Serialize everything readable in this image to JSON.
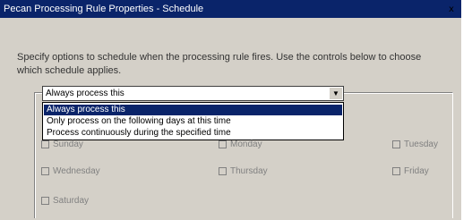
{
  "window": {
    "title": "Pecan Processing Rule Properties - Schedule",
    "close_glyph": "x"
  },
  "description": "Specify options to schedule when the processing rule fires. Use the controls below to choose which schedule applies.",
  "schedule_combo": {
    "value": "Always process this",
    "options": [
      "Always process this",
      "Only process on the following days at this time",
      "Process continuously during the specified time"
    ],
    "selected_index": 0
  },
  "days": [
    {
      "label": "Sunday",
      "checked": false
    },
    {
      "label": "Monday",
      "checked": false
    },
    {
      "label": "Tuesday",
      "checked": false
    },
    {
      "label": "Wednesday",
      "checked": false
    },
    {
      "label": "Thursday",
      "checked": false
    },
    {
      "label": "Friday",
      "checked": false
    },
    {
      "label": "Saturday",
      "checked": false
    }
  ]
}
